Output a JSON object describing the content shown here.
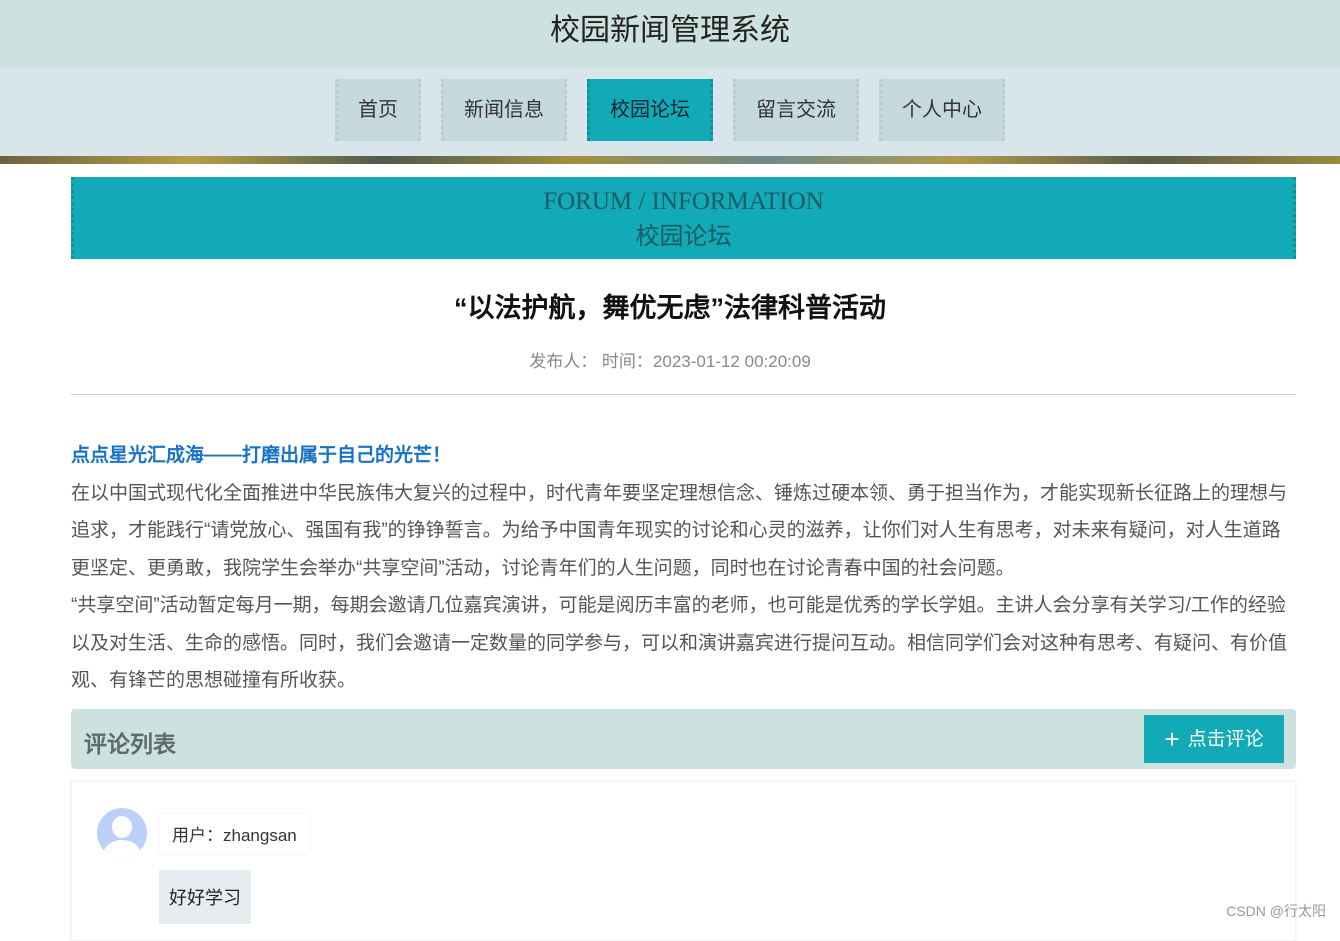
{
  "app_title": "校园新闻管理系统",
  "nav": [
    {
      "label": "首页"
    },
    {
      "label": "新闻信息"
    },
    {
      "label": "校园论坛",
      "active": true
    },
    {
      "label": "留言交流"
    },
    {
      "label": "个人中心"
    }
  ],
  "banner": {
    "en": "FORUM / INFORMATION",
    "cn": "校园论坛"
  },
  "article": {
    "title": "“以法护航，舞优无虑”法律科普活动",
    "meta": "发布人：  时间：2023-01-12 00:20:09",
    "highlight": "点点星光汇成海——打磨出属于自己的光芒！",
    "p1": "在以中国式现代化全面推进中华民族伟大复兴的过程中，时代青年要坚定理想信念、锤炼过硬本领、勇于担当作为，才能实现新长征路上的理想与追求，才能践行“请党放心、强国有我”的铮铮誓言。为给予中国青年现实的讨论和心灵的滋养，让你们对人生有思考，对未来有疑问，对人生道路更坚定、更勇敢，我院学生会举办“共享空间”活动，讨论青年们的人生问题，同时也在讨论青春中国的社会问题。",
    "p2": "“共享空间”活动暂定每月一期，每期会邀请几位嘉宾演讲，可能是阅历丰富的老师，也可能是优秀的学长学姐。主讲人会分享有关学习/工作的经验以及对生活、生命的感悟。同时，我们会邀请一定数量的同学参与，可以和演讲嘉宾进行提问互动。相信同学们会对这种有思考、有疑问、有价值观、有锋芒的思想碰撞有所收获。"
  },
  "comments": {
    "header": "评论列表",
    "add_label": "点击评论",
    "items": [
      {
        "user": "用户：zhangsan",
        "text": "好好学习"
      }
    ]
  },
  "watermark": "CSDN @行太阳",
  "colors": {
    "accent": "#12aab6",
    "header_bg": "#cde1de",
    "link": "#1772c4"
  }
}
